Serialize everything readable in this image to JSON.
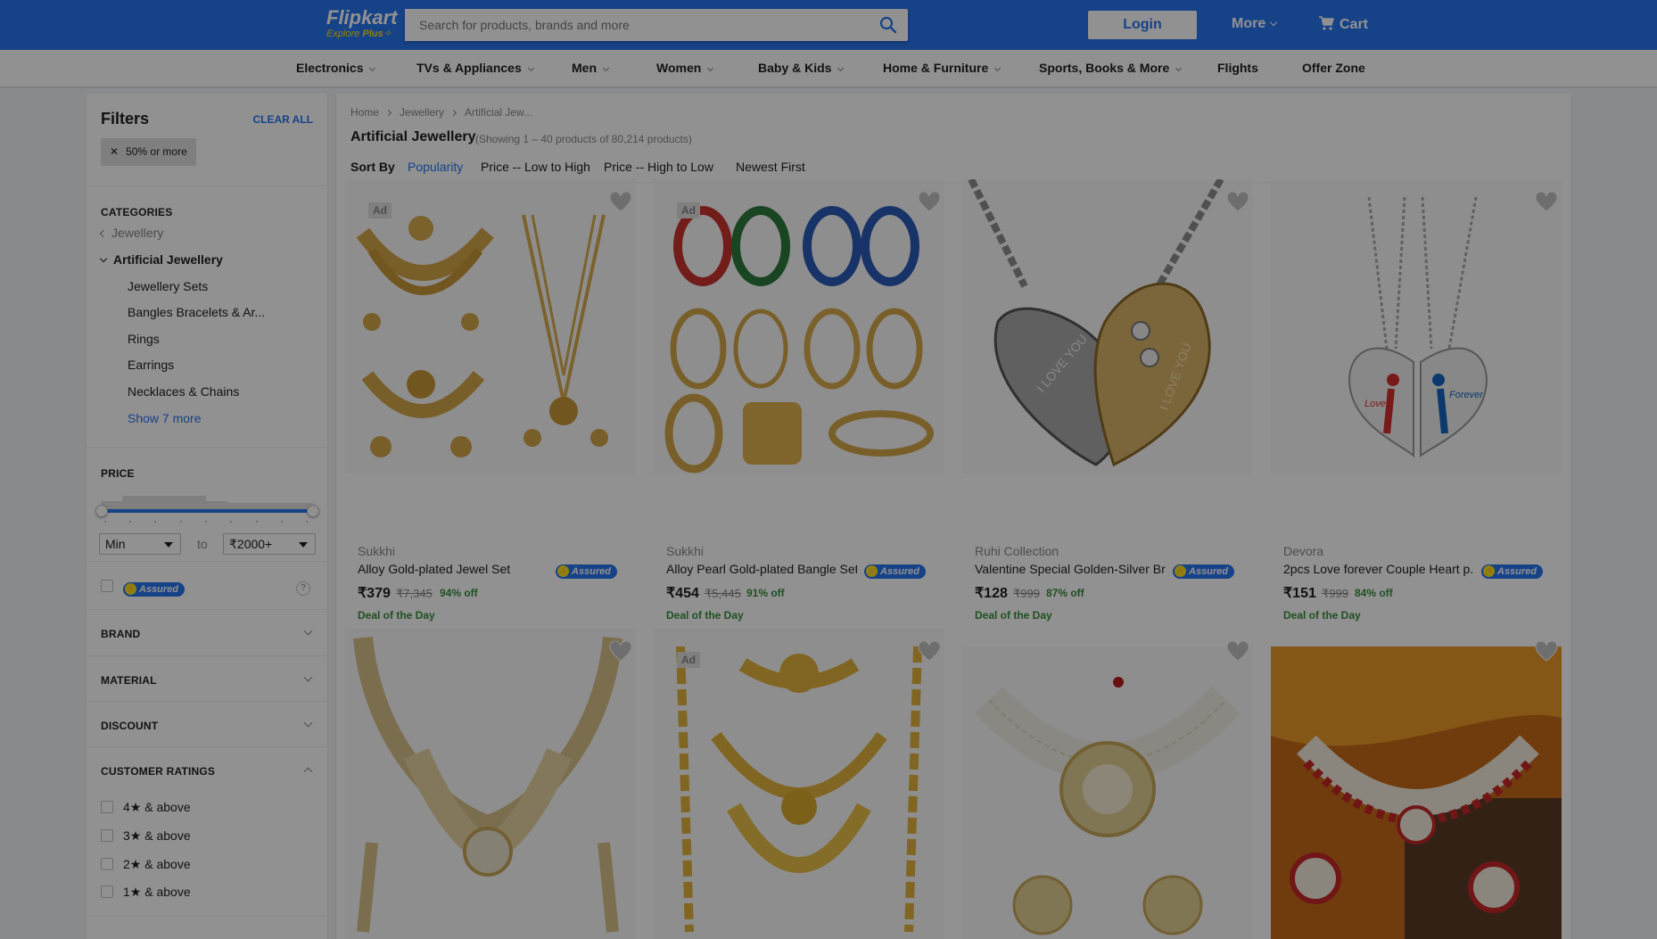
{
  "header": {
    "logo_text": "Flipkart",
    "logo_sub": "Explore",
    "logo_plus": "Plus",
    "search_placeholder": "Search for products, brands and more",
    "login_label": "Login",
    "more_label": "More",
    "cart_label": "Cart",
    "accent_color": "#2874f0",
    "logo_accent": "#ffe11b"
  },
  "catnav": [
    {
      "label": "Electronics",
      "dropdown": true
    },
    {
      "label": "TVs & Appliances",
      "dropdown": true
    },
    {
      "label": "Men",
      "dropdown": true
    },
    {
      "label": "Women",
      "dropdown": true
    },
    {
      "label": "Baby & Kids",
      "dropdown": true
    },
    {
      "label": "Home & Furniture",
      "dropdown": true
    },
    {
      "label": "Sports, Books & More",
      "dropdown": true
    },
    {
      "label": "Flights",
      "dropdown": false
    },
    {
      "label": "Offer Zone",
      "dropdown": false
    }
  ],
  "filters": {
    "title": "Filters",
    "clear_all": "CLEAR ALL",
    "applied": [
      "50% or more"
    ],
    "categories_label": "CATEGORIES",
    "parent_category": "Jewellery",
    "current_category": "Artificial Jewellery",
    "subcategories": [
      "Jewellery Sets",
      "Bangles Bracelets & Ar...",
      "Rings",
      "Earrings",
      "Necklaces & Chains"
    ],
    "show_more": "Show 7 more",
    "price_label": "PRICE",
    "price_min": "Min",
    "price_to": "to",
    "price_max": "₹2000+",
    "assured_label": "Assured",
    "help_icon": "?",
    "brand_label": "BRAND",
    "material_label": "MATERIAL",
    "discount_label": "DISCOUNT",
    "ratings_label": "CUSTOMER RATINGS",
    "ratings": [
      "4★ & above",
      "3★ & above",
      "2★ & above",
      "1★ & above"
    ]
  },
  "main": {
    "breadcrumb": [
      "Home",
      "Jewellery",
      "Artificial Jew..."
    ],
    "title": "Artificial Jewellery",
    "showing": "(Showing 1 – 40 products of 80,214 products)",
    "sort_label": "Sort By",
    "sort_options": [
      "Popularity",
      "Price -- Low to High",
      "Price -- High to Low",
      "Newest First"
    ],
    "active_sort": "Popularity",
    "ad_label": "Ad",
    "products": [
      {
        "brand": "Sukkhi",
        "title": "Alloy Gold-plated Jewel Set",
        "price": "₹379",
        "mrp": "₹7,345",
        "off": "94% off",
        "deal": "Deal of the Day",
        "ad": true,
        "assured": "Assured"
      },
      {
        "brand": "Sukkhi",
        "title": "Alloy Pearl Gold-plated Bangle Set",
        "price": "₹454",
        "mrp": "₹5,445",
        "off": "91% off",
        "deal": "Deal of the Day",
        "ad": true,
        "assured": "Assured"
      },
      {
        "brand": "Ruhi Collection",
        "title": "Valentine Special Golden-Silver Br...",
        "price": "₹128",
        "mrp": "₹999",
        "off": "87% off",
        "deal": "Deal of the Day",
        "ad": false,
        "assured": "Assured"
      },
      {
        "brand": "Devora",
        "title": "2pcs Love forever Couple Heart p...",
        "price": "₹151",
        "mrp": "₹999",
        "off": "84% off",
        "deal": "Deal of the Day",
        "ad": false,
        "assured": "Assured"
      },
      {
        "ad": false
      },
      {
        "ad": true
      },
      {
        "ad": false
      },
      {
        "ad": false
      }
    ],
    "pendant_text_1": "Love",
    "pendant_text_2": "Forever",
    "heart_text_1": "I LOVE YOU",
    "heart_text_2": "I LOVE YOU"
  }
}
